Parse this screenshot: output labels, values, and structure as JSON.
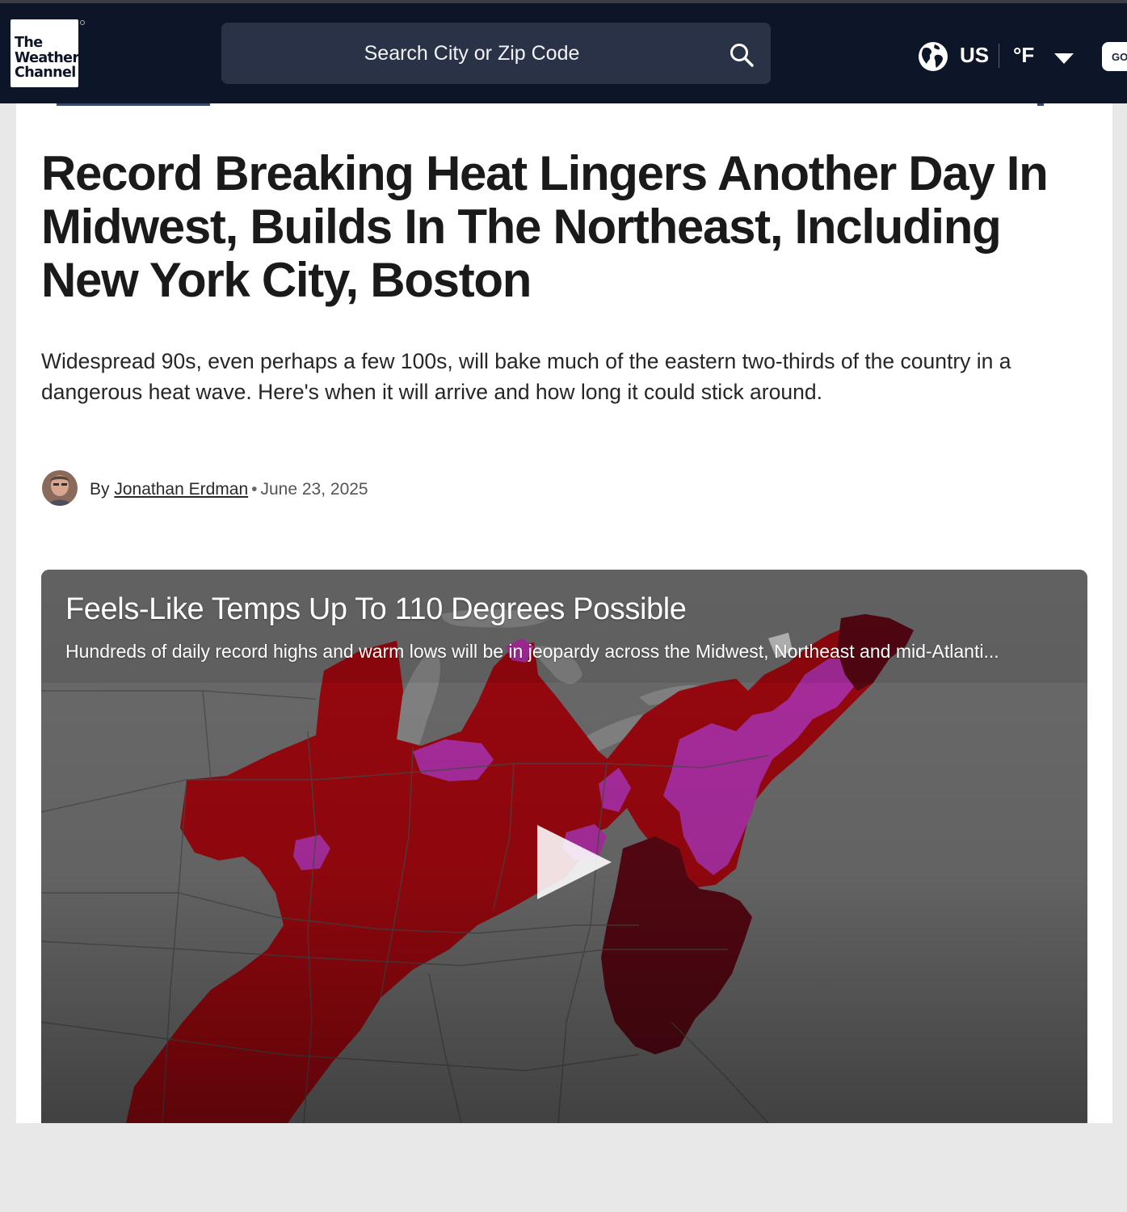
{
  "header": {
    "logo": {
      "line1": "The",
      "line2": "Weather",
      "line3": "Channel"
    },
    "search": {
      "placeholder": "Search City or Zip Code"
    },
    "region": "US",
    "unit": "°F",
    "go_button_label": "GO"
  },
  "article": {
    "headline": "Record Breaking Heat Lingers Another Day In Midwest, Builds In The Northeast, Including New York City, Boston",
    "dek": "Widespread 90s, even perhaps a few 100s, will bake much of the eastern two-thirds of the country in a dangerous heat wave. Here's when it will arrive and how long it could stick around.",
    "byline": {
      "prefix": "By",
      "author": "Jonathan Erdman",
      "separator": "•",
      "date": "June 23, 2025"
    }
  },
  "video": {
    "title": "Feels-Like Temps Up To 110 Degrees Possible",
    "description": "Hundreds of daily record highs and warm lows will be in jeopardy across the Midwest, Northeast and mid-Atlanti..."
  },
  "colors": {
    "header_bg": "#0d1528",
    "search_bg": "#2a3248",
    "heat_red": "#a0080f",
    "heat_magenta": "#b22fa6",
    "heat_dark": "#5a0814"
  }
}
